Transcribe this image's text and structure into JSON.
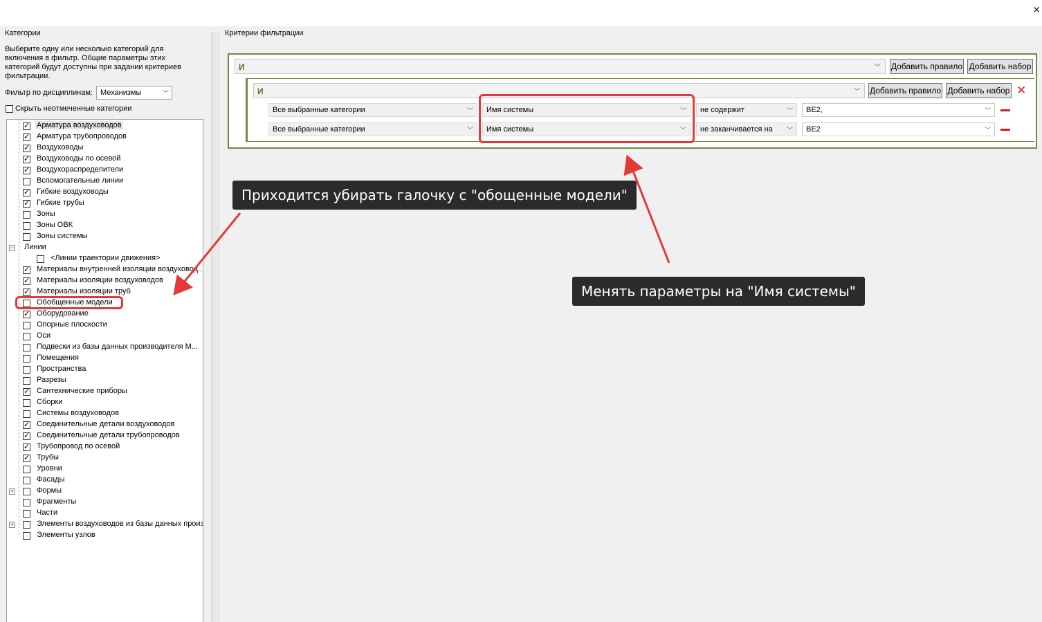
{
  "window": {
    "close_glyph": "✕"
  },
  "left": {
    "title": "Категории",
    "description": "Выберите одну или несколько категорий для включения в фильтр. Общие параметры этих категорий будут доступны при задании критериев фильтрации.",
    "discipline_label": "Фильтр по дисциплинам:",
    "discipline_value": "Механизмы",
    "hide_unchecked_label": "Скрыть неотмеченные категории",
    "categories": [
      {
        "label": "Арматура воздуховодов",
        "checked": true,
        "selected": true
      },
      {
        "label": "Арматура трубопроводов",
        "checked": true
      },
      {
        "label": "Воздуховоды",
        "checked": true
      },
      {
        "label": "Воздуховоды по осевой",
        "checked": true
      },
      {
        "label": "Воздухораспределители",
        "checked": true
      },
      {
        "label": "Вспомогательные линии",
        "checked": false
      },
      {
        "label": "Гибкие воздуховоды",
        "checked": true
      },
      {
        "label": "Гибкие трубы",
        "checked": true
      },
      {
        "label": "Зоны",
        "checked": false
      },
      {
        "label": "Зоны ОВК",
        "checked": false
      },
      {
        "label": "Зоны системы",
        "checked": false
      },
      {
        "label": "Линии",
        "group": true,
        "expander": "−"
      },
      {
        "label": "<Линии траектории движения>",
        "checked": false,
        "child": true
      },
      {
        "label": "Материалы внутренней изоляции воздуховод...",
        "checked": true
      },
      {
        "label": "Материалы изоляции воздуховодов",
        "checked": true
      },
      {
        "label": "Материалы изоляции труб",
        "checked": true
      },
      {
        "label": "Обобщенные модели",
        "checked": false
      },
      {
        "label": "Оборудование",
        "checked": true
      },
      {
        "label": "Опорные плоскости",
        "checked": false
      },
      {
        "label": "Оси",
        "checked": false
      },
      {
        "label": "Подвески из базы данных производителя М...",
        "checked": false
      },
      {
        "label": "Помещения",
        "checked": false
      },
      {
        "label": "Пространства",
        "checked": false
      },
      {
        "label": "Разрезы",
        "checked": false
      },
      {
        "label": "Сантехнические приборы",
        "checked": true
      },
      {
        "label": "Сборки",
        "checked": false
      },
      {
        "label": "Системы воздуховодов",
        "checked": false
      },
      {
        "label": "Соединительные детали воздуховодов",
        "checked": true
      },
      {
        "label": "Соединительные детали трубопроводов",
        "checked": true
      },
      {
        "label": "Трубопровод по осевой",
        "checked": true
      },
      {
        "label": "Трубы",
        "checked": true
      },
      {
        "label": "Уровни",
        "checked": false
      },
      {
        "label": "Фасады",
        "checked": false
      },
      {
        "label": "Формы",
        "checked": false,
        "expander": "+"
      },
      {
        "label": "Фрагменты",
        "checked": false
      },
      {
        "label": "Части",
        "checked": false
      },
      {
        "label": "Элементы воздуховодов из базы данных произ",
        "checked": false,
        "expander": "+"
      },
      {
        "label": "Элементы узлов",
        "checked": false
      }
    ]
  },
  "right": {
    "title": "Критерии фильтрации",
    "outer_group": {
      "operator": "И",
      "add_rule": "Добавить правило",
      "add_set": "Добавить набор"
    },
    "inner_group": {
      "operator": "И",
      "add_rule": "Добавить правило",
      "add_set": "Добавить набор",
      "delete_glyph": "✕"
    },
    "rules": [
      {
        "category": "Все выбранные категории",
        "parameter": "Имя системы",
        "operator": "не содержит",
        "value": "ВЕ2,"
      },
      {
        "category": "Все выбранные категории",
        "parameter": "Имя системы",
        "operator": "не заканчивается на",
        "value": "ВЕ2"
      }
    ]
  },
  "annotations": {
    "callout_left": "Приходится убирать галочку с \"обощенные модели\"",
    "callout_right": "Менять параметры на \"Имя системы\"",
    "accent_color": "#e53935"
  }
}
